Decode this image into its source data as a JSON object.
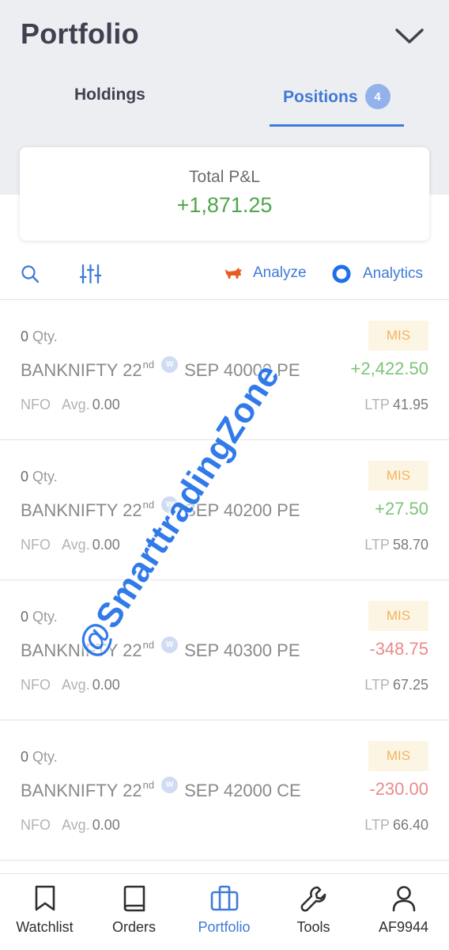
{
  "header": {
    "title": "Portfolio",
    "collapse_icon": "chevron-down-icon"
  },
  "tabs": [
    {
      "label": "Holdings",
      "active": false
    },
    {
      "label": "Positions",
      "badge": "4",
      "active": true
    }
  ],
  "summary": {
    "label": "Total P&L",
    "value": "+1,871.25",
    "value_color": "#4da64a"
  },
  "toolbar": {
    "search_icon": "search-icon",
    "filter_icon": "sliders-icon",
    "analyze_label": "Analyze",
    "analytics_label": "Analytics",
    "accent_color": "#3f7ad8"
  },
  "positions": [
    {
      "qty": "0",
      "qty_unit": "Qty.",
      "symbol": "BANKNIFTY 22",
      "sup": "nd",
      "week_badge": "W",
      "contract": "SEP 40000 PE",
      "exchange": "NFO",
      "avg_label": "Avg.",
      "avg": "0.00",
      "product": "MIS",
      "pnl": "+2,422.50",
      "ltp_label": "LTP",
      "ltp": "41.95"
    },
    {
      "qty": "0",
      "qty_unit": "Qty.",
      "symbol": "BANKNIFTY 22",
      "sup": "nd",
      "week_badge": "W",
      "contract": "SEP 40200 PE",
      "exchange": "NFO",
      "avg_label": "Avg.",
      "avg": "0.00",
      "product": "MIS",
      "pnl": "+27.50",
      "ltp_label": "LTP",
      "ltp": "58.70"
    },
    {
      "qty": "0",
      "qty_unit": "Qty.",
      "symbol": "BANKNIFTY 22",
      "sup": "nd",
      "week_badge": "W",
      "contract": "SEP 40300 PE",
      "exchange": "NFO",
      "avg_label": "Avg.",
      "avg": "0.00",
      "product": "MIS",
      "pnl": "-348.75",
      "ltp_label": "LTP",
      "ltp": "67.25"
    },
    {
      "qty": "0",
      "qty_unit": "Qty.",
      "symbol": "BANKNIFTY 22",
      "sup": "nd",
      "week_badge": "W",
      "contract": "SEP 42000 CE",
      "exchange": "NFO",
      "avg_label": "Avg.",
      "avg": "0.00",
      "product": "MIS",
      "pnl": "-230.00",
      "ltp_label": "LTP",
      "ltp": "66.40"
    }
  ],
  "watermark": "@SmarttradingZone",
  "bottom_nav": [
    {
      "label": "Watchlist",
      "icon": "bookmark-icon"
    },
    {
      "label": "Orders",
      "icon": "book-icon"
    },
    {
      "label": "Portfolio",
      "icon": "briefcase-icon",
      "active": true
    },
    {
      "label": "Tools",
      "icon": "wrench-icon"
    },
    {
      "label": "AF9944",
      "icon": "user-icon"
    }
  ]
}
